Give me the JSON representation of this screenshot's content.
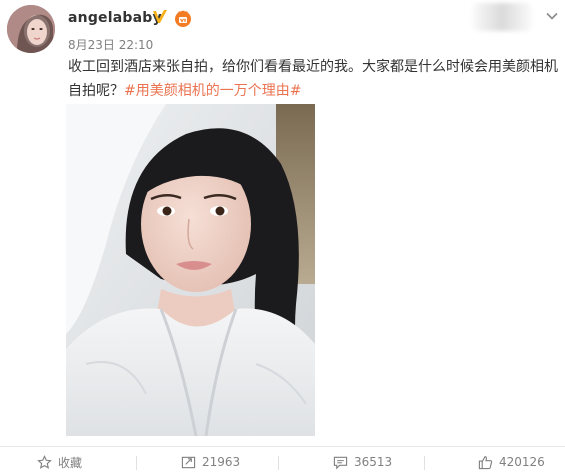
{
  "post": {
    "username": "angelababy",
    "timestamp": "8月23日 22:10",
    "content_line1": "收工回到酒店来张自拍，给你们看看最近的我。大家都是什么时候会用美颜相机",
    "content_line2_prefix": "自拍呢？",
    "hashtag": "#用美颜相机的一万个理由#"
  },
  "actions": {
    "favorite_label": "收藏",
    "repost_count": "21963",
    "comment_count": "36513",
    "like_count": "420126"
  },
  "icons": {
    "verified": "verified-v-icon",
    "vip": "vip-crown-icon",
    "menu": "chevron-down-icon",
    "favorite": "star-outline-icon",
    "repost": "repost-icon",
    "comment": "comment-icon",
    "like": "thumbs-up-icon"
  },
  "colors": {
    "hashtag": "#eb7350",
    "verified": "#f8b11a",
    "vip": "#f37b23",
    "text": "#333333",
    "muted": "#808080"
  }
}
